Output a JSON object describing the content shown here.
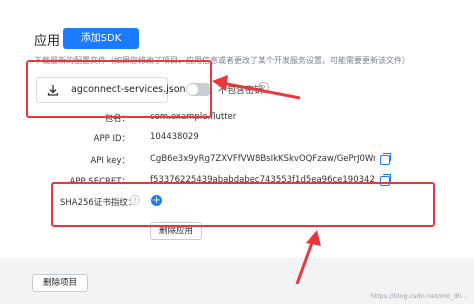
{
  "section": {
    "title": "应用",
    "add_sdk_label": "添加SDK"
  },
  "config_hint": "下载最新的配置文件（如果您修改了项目、应用信息或者更改了某个开发服务设置，可能需要更新该文件）",
  "download": {
    "file_label": "agconnect-services.json"
  },
  "toggle": {
    "label": "不包含密钥",
    "help": "?"
  },
  "app_info": {
    "package": {
      "label": "包名：",
      "value": "com.example.flutter"
    },
    "app_id": {
      "label": "APP ID：",
      "value": "104438029"
    },
    "api_key": {
      "label": "API key：",
      "value": "CgB6e3x9yRg7ZXVFfVW8BsIkKSkvOQFzaw/GePrJ0Wrrbtahvr"
    },
    "app_secret": {
      "label": "APP SECRET：",
      "value": "f53376225439ababdabec743553f1d5ea96ce1903424c25e78"
    }
  },
  "sha": {
    "label": "SHA256证书指纹：",
    "help": "?",
    "add": "+"
  },
  "delete_app_label": "删除应用",
  "delete_project_label": "删除项目",
  "watermark": "https://blog.csdn.net/m0_dh..."
}
